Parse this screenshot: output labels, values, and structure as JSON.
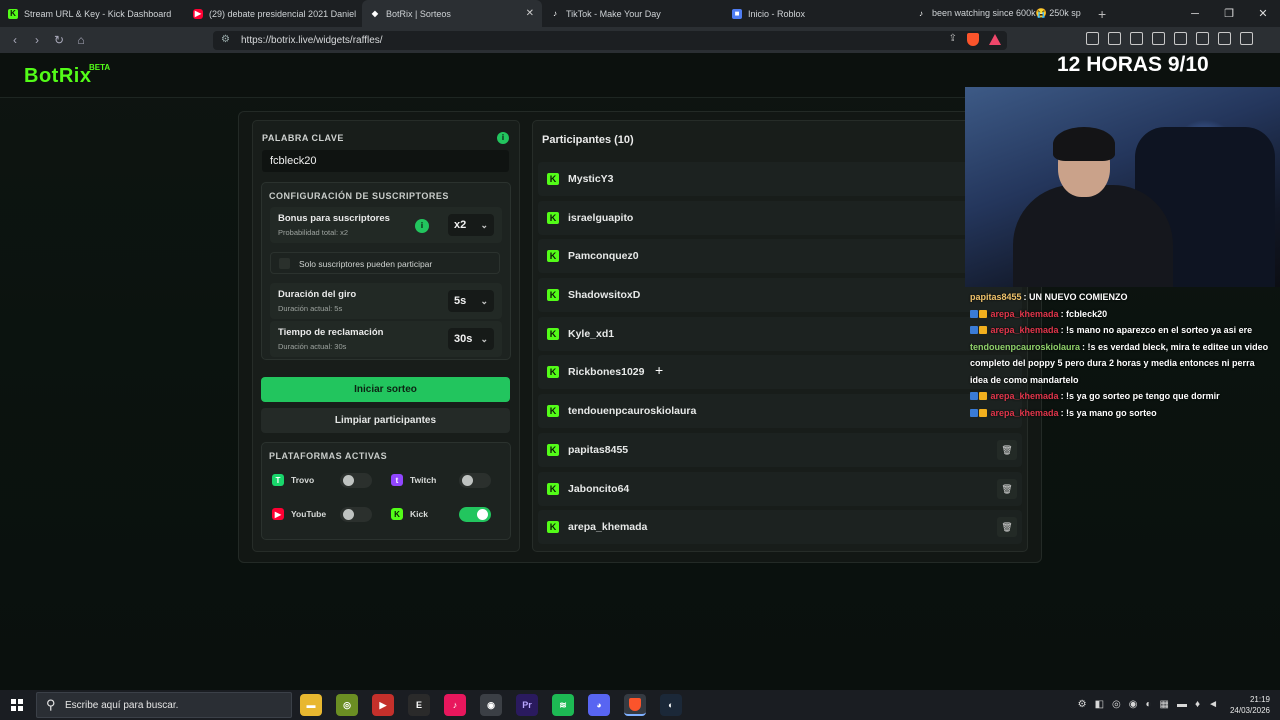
{
  "browser": {
    "tabs": [
      {
        "label": "Stream URL & Key - Kick Dashboard",
        "favicon": "kick-icon",
        "color": "#53fc18"
      },
      {
        "label": "(29) debate presidencial 2021 Daniel",
        "favicon": "youtube-icon",
        "color": "#ff0033"
      },
      {
        "label": "BotRix | Sorteos",
        "favicon": "botrix-icon",
        "color": "#ffffff",
        "active": true
      },
      {
        "label": "TikTok - Make Your Day",
        "favicon": "tiktok-icon",
        "color": "#ffffff"
      },
      {
        "label": "Inicio - Roblox",
        "favicon": "roblox-icon",
        "color": "#4f7df3"
      },
      {
        "label": "been watching since 600k😭 250k sp",
        "favicon": "tiktok-icon",
        "color": "#ffffff"
      }
    ],
    "url": "https://botrix.live/widgets/raffles/"
  },
  "brand": {
    "name": "BotRix",
    "badge": "BETA"
  },
  "overlay": {
    "title": "12 HORAS 9/10",
    "chat": [
      {
        "user": "papitas8455",
        "user_color": "#f0c36b",
        "text": ": UN NUEVO COMIENZO",
        "badges": 0
      },
      {
        "user": "arepa_khemada",
        "user_color": "#e0364b",
        "text": ": fcbleck20",
        "badges": 2
      },
      {
        "user": "arepa_khemada",
        "user_color": "#e0364b",
        "text": ": !s mano no aparezco en el sorteo ya asi ere",
        "badges": 2
      },
      {
        "user": "tendouenpcauroskiolaura",
        "user_color": "#8fd16a",
        "text": ": !s es verdad bleck, mira te editee un video completo del poppy 5 pero dura 2 horas y media entonces ni perra idea de como mandartelo",
        "badges": 0
      },
      {
        "user": "arepa_khemada",
        "user_color": "#e0364b",
        "text": ": !s ya go sorteo pe tengo que dormir",
        "badges": 2
      },
      {
        "user": "arepa_khemada",
        "user_color": "#e0364b",
        "text": ": !s ya mano go sorteo",
        "badges": 2
      }
    ]
  },
  "raffle": {
    "keyword_label": "PALABRA CLAVE",
    "keyword_value": "fcbleck20",
    "sub_config_title": "CONFIGURACIÓN DE SUSCRIPTORES",
    "bonus_title": "Bonus para suscriptores",
    "bonus_sub": "Probabilidad total: x2",
    "bonus_value": "x2",
    "subs_only_label": "Solo suscriptores pueden participar",
    "spin_title": "Duración del giro",
    "spin_sub": "Duración actual: 5s",
    "spin_value": "5s",
    "claim_title": "Tiempo de reclamación",
    "claim_sub": "Duración actual: 30s",
    "claim_value": "30s",
    "start_button": "Iniciar sorteo",
    "clear_button": "Limpiar participantes",
    "platforms_title": "PLATAFORMAS ACTIVAS",
    "platforms": [
      {
        "name": "Trovo",
        "icon": "trovo-icon",
        "color": "#19d66b",
        "enabled": false
      },
      {
        "name": "Twitch",
        "icon": "twitch-icon",
        "color": "#9146ff",
        "enabled": false
      },
      {
        "name": "YouTube",
        "icon": "youtube-icon",
        "color": "#ff0033",
        "enabled": false
      },
      {
        "name": "Kick",
        "icon": "kick-icon",
        "color": "#53fc18",
        "enabled": true
      }
    ]
  },
  "participants": {
    "title": "Participantes (10)",
    "list": [
      "MysticY3",
      "israelguapito",
      "Pamconquez0",
      "ShadowsitoxD",
      "Kyle_xd1",
      "Rickbones1029",
      "tendouenpcauroskiolaura",
      "papitas8455",
      "Jaboncito64",
      "arepa_khemada"
    ]
  },
  "taskbar": {
    "search_placeholder": "Escribe aquí para buscar.",
    "time": "21:19",
    "date": "24/03/2026"
  },
  "colors": {
    "accent": "#22c55e",
    "kick": "#53fc18"
  }
}
